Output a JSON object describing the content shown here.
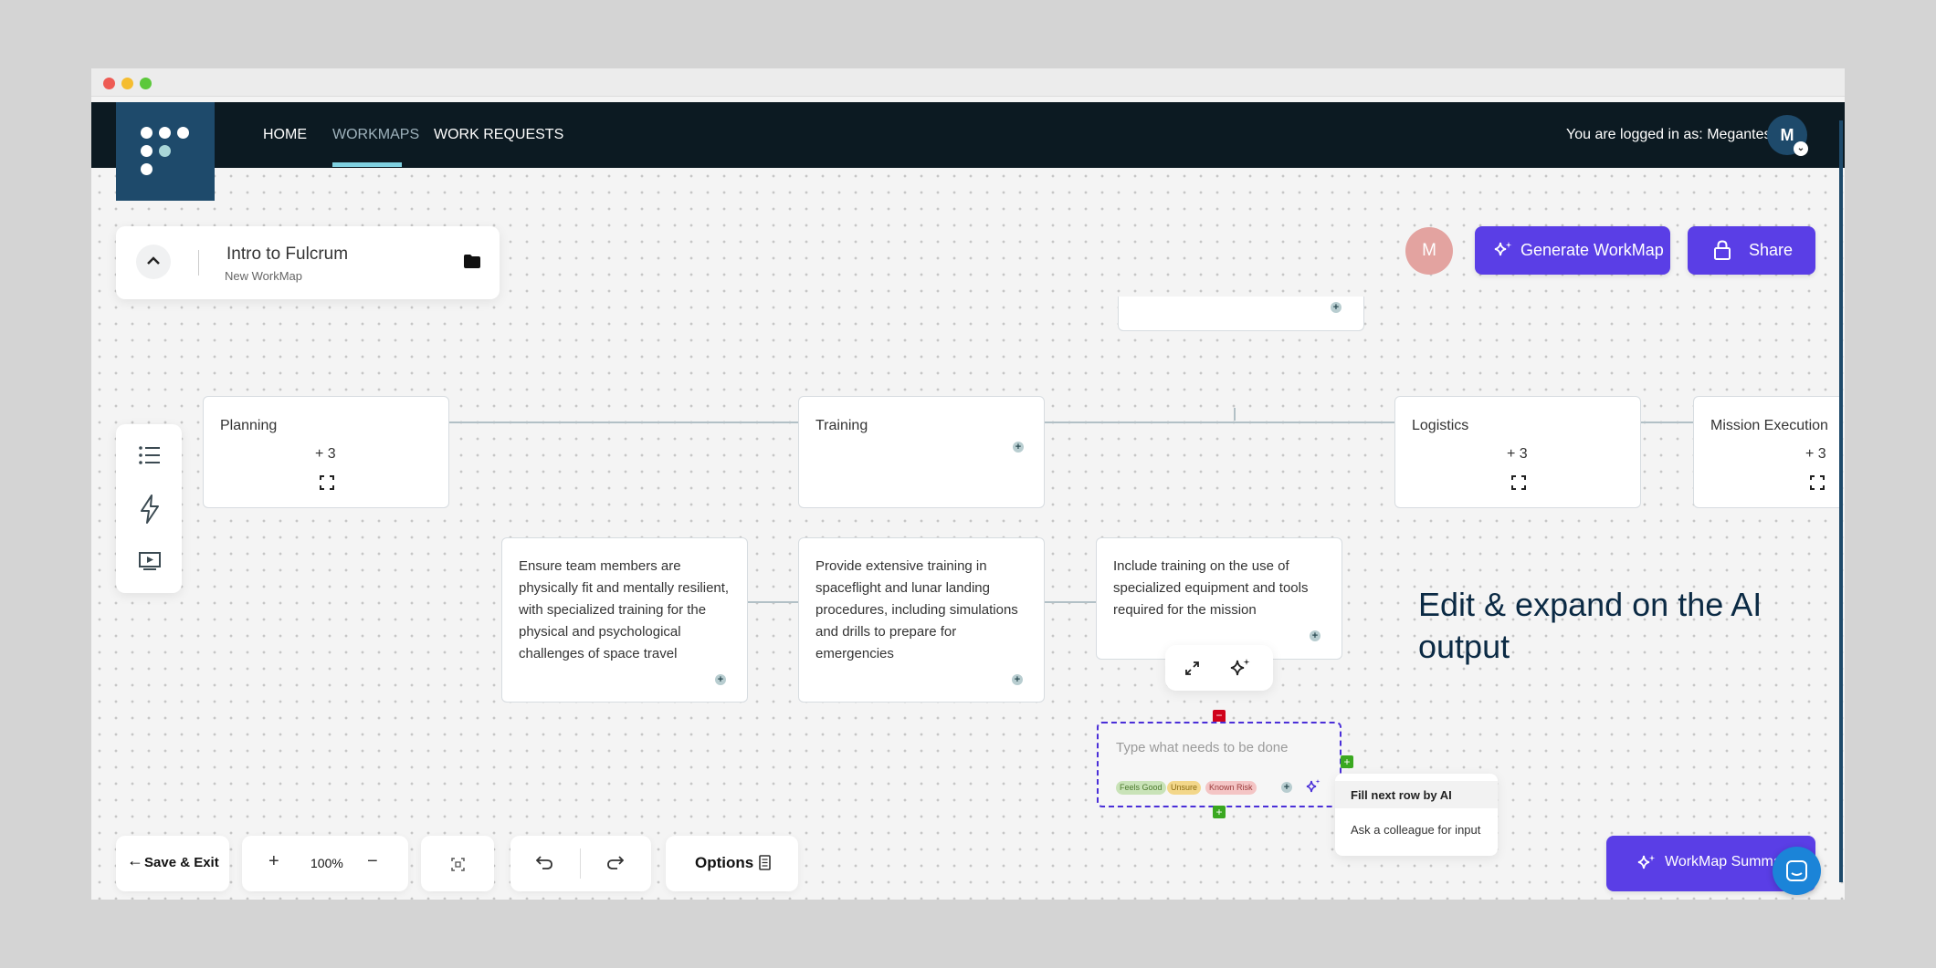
{
  "nav": {
    "home": "HOME",
    "workmaps": "WORKMAPS",
    "work_requests": "WORK REQUESTS",
    "login": "You are logged in as: Megantest",
    "avatar": "M"
  },
  "workmap": {
    "title": "Intro to Fulcrum",
    "subtitle": "New WorkMap"
  },
  "collaborator_avatar": "M",
  "actions": {
    "generate": "Generate WorkMap",
    "share": "Share",
    "summary": "WorkMap Summa"
  },
  "nodes": {
    "planning": {
      "title": "Planning",
      "count": "+ 3"
    },
    "training": {
      "title": "Training"
    },
    "logistics": {
      "title": "Logistics",
      "count": "+ 3"
    },
    "mission": {
      "title": "Mission Execution",
      "count": "+ 3"
    }
  },
  "tasks": [
    "Ensure team members are physically fit and mentally resilient, with specialized training for the physical and psychological challenges of space travel",
    "Provide extensive training in spaceflight and lunar landing procedures, including simulations and drills to prepare for emergencies",
    "Include training on the use of specialized equipment and tools required for the mission"
  ],
  "new_task": {
    "placeholder": "Type what needs to be done",
    "tags": [
      "Feels Good",
      "Unsure",
      "Known Risk"
    ]
  },
  "menu": {
    "item1": "Fill next row by AI",
    "item2": "Ask a colleague for input"
  },
  "annotation": "Edit & expand on the AI output",
  "bottom": {
    "save": "Save & Exit",
    "zoom": "100%",
    "options": "Options"
  },
  "colors": {
    "accent": "#5a3ee6",
    "nav": "#0c1a22",
    "logo": "#1e4a6b"
  }
}
